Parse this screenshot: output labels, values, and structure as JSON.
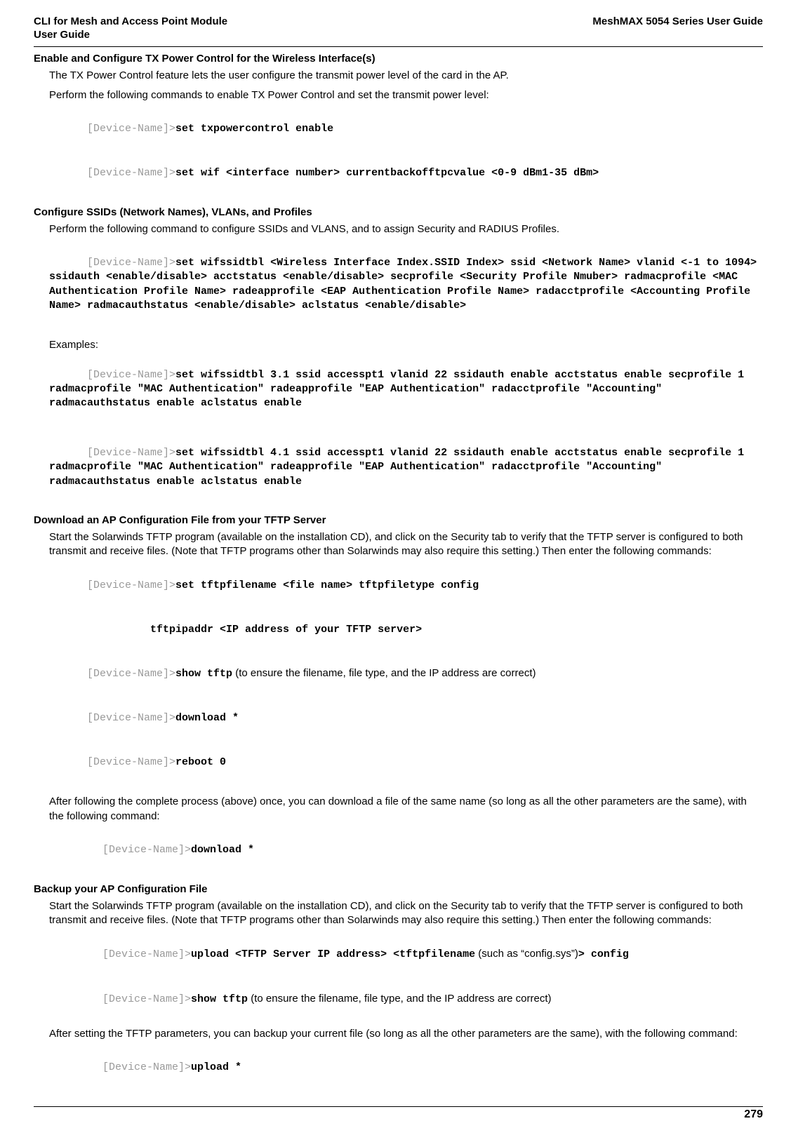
{
  "header": {
    "left_line1": "CLI for Mesh and Access Point Module",
    "left_line2": " User Guide",
    "right": "MeshMAX 5054 Series User Guide"
  },
  "sections": {
    "s1": {
      "heading": "Enable and Configure TX Power Control for the Wireless Interface(s)",
      "p1": "The TX Power Control feature lets the user configure the transmit power level of the card in the AP.",
      "p2": "Perform the following commands to enable TX Power Control and set the transmit power level:",
      "c1_prompt": "[Device-Name]>",
      "c1_cmd": "set txpowercontrol enable",
      "c2_prompt": "[Device-Name]>",
      "c2_cmd": "set wif <interface number> currentbackofftpcvalue <0-9 dBm1-35 dBm>"
    },
    "s2": {
      "heading": "Configure SSIDs (Network Names), VLANs, and Profiles",
      "p1": "Perform the following command to configure SSIDs and VLANS, and to assign Security and RADIUS Profiles.",
      "c1_prompt": "[Device-Name]>",
      "c1_cmd": "set wifssidtbl <Wireless Interface Index.SSID Index> ssid <Network Name> vlanid <-1 to 1094> ssidauth <enable/disable> acctstatus <enable/disable> secprofile <Security Profile Nmuber> radmacprofile <MAC Authentication Profile Name> radeapprofile <EAP Authentication Profile Name> radacctprofile <Accounting Profile Name> radmacauthstatus <enable/disable> aclstatus <enable/disable>",
      "examples_label": "Examples:",
      "c2_prompt": "[Device-Name]>",
      "c2_cmd": "set wifssidtbl 3.1 ssid accesspt1 vlanid 22 ssidauth enable acctstatus enable secprofile 1 radmacprofile \"MAC Authentication\" radeapprofile \"EAP Authentication\" radacctprofile \"Accounting\" radmacauthstatus enable aclstatus enable",
      "c3_prompt": "[Device-Name]>",
      "c3_cmd": "set wifssidtbl 4.1 ssid accesspt1 vlanid 22 ssidauth enable acctstatus enable secprofile 1 radmacprofile \"MAC Authentication\" radeapprofile \"EAP Authentication\" radacctprofile \"Accounting\" radmacauthstatus enable aclstatus enable"
    },
    "s3": {
      "heading": "Download an AP Configuration File from your TFTP Server",
      "p1": "Start the Solarwinds TFTP program (available on the installation CD), and click on the Security tab to verify that the TFTP server is configured to both transmit and receive files. (Note that TFTP programs other than Solarwinds may also require this setting.) Then enter the following commands:",
      "c1_prompt": "[Device-Name]>",
      "c1_cmd": "set tftpfilename <file name> tftpfiletype config",
      "c1b_cmd": "          tftpipaddr <IP address of your TFTP server>",
      "c2_prompt": "[Device-Name]>",
      "c2_cmd": "show tftp",
      "c2_note": " (to ensure the filename, file type, and the IP address are correct)",
      "c3_prompt": "[Device-Name]>",
      "c3_cmd": "download *",
      "c4_prompt": "[Device-Name]>",
      "c4_cmd": "reboot 0",
      "p2": "After following the complete process (above) once, you can download a file of the same name (so long as all the other parameters are the same), with the following command:",
      "c5_prompt": "[Device-Name]>",
      "c5_cmd": "download *"
    },
    "s4": {
      "heading": "Backup your AP Configuration File",
      "p1": "Start the Solarwinds TFTP program (available on the installation CD), and click on the Security tab to verify that the TFTP server is configured to both transmit and receive files. (Note that TFTP programs other than Solarwinds may also require this setting.) Then enter the following commands:",
      "c1_prompt": "[Device-Name]>",
      "c1_cmd_a": "upload <TFTP Server IP address> <tftpfilename",
      "c1_note": " (such as “config.sys”)",
      "c1_cmd_b": "> config",
      "c2_prompt": "[Device-Name]>",
      "c2_cmd": "show tftp",
      "c2_note": " (to ensure the filename, file type, and the IP address are correct)",
      "p2": "After setting the TFTP parameters, you can backup your current file (so long as all the other parameters are the same), with the following command:",
      "c3_prompt": "[Device-Name]>",
      "c3_cmd": "upload *"
    }
  },
  "pagenum": "279"
}
